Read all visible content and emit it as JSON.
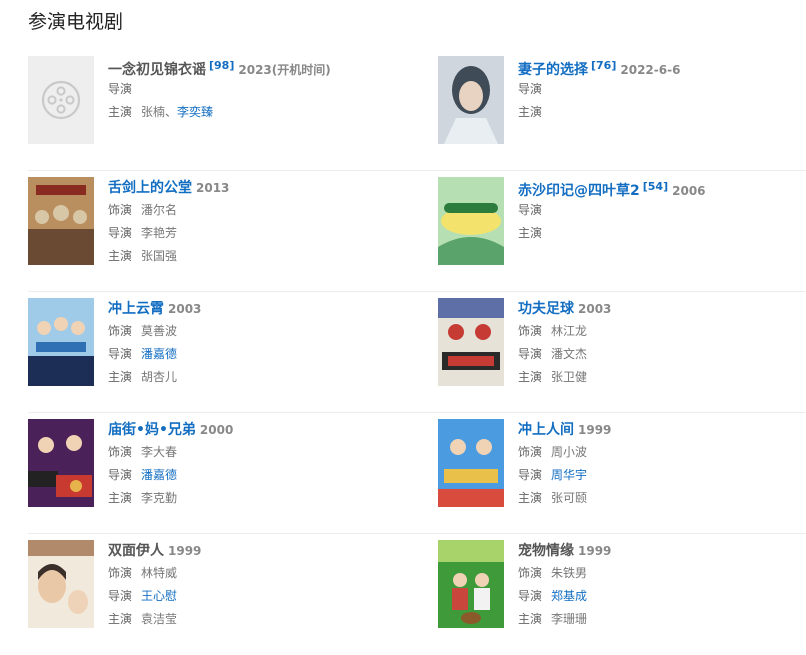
{
  "section_title": "参演电视剧",
  "labels": {
    "role": "饰演",
    "director": "导演",
    "star": "主演"
  },
  "items": [
    {
      "title": "一念初见锦衣谣",
      "ref": "[98]",
      "year": "2023(开机时间)",
      "director": "",
      "star_1": "张楠",
      "star_sep": "、",
      "star_2": "李奕臻",
      "poster": "film-reel-placeholder"
    },
    {
      "title": "妻子的选择",
      "ref": "[76]",
      "year": "2022-6-6",
      "director": "",
      "star": "",
      "poster_colors": [
        "#cfd6de",
        "#3f4c57",
        "#e8d2c2"
      ]
    },
    {
      "title": "舌剑上的公堂",
      "year": "2013",
      "role": "潘尔名",
      "director": "李艳芳",
      "star": "张国强",
      "poster_colors": [
        "#b98f5f",
        "#6b4a33",
        "#d8c7a6"
      ]
    },
    {
      "title": "赤沙印记@四叶草2",
      "ref": "[54]",
      "year": "2006",
      "director": "",
      "star": "",
      "poster_colors": [
        "#5aa36a",
        "#b6e0b3",
        "#f3e36d"
      ]
    },
    {
      "title": "冲上云霄",
      "year": "2003",
      "role": "莫善波",
      "director": "潘嘉德",
      "star": "胡杏儿",
      "poster_colors": [
        "#2f6fb3",
        "#9fcbe8",
        "#1c2e55"
      ]
    },
    {
      "title": "功夫足球",
      "year": "2003",
      "role": "林江龙",
      "director": "潘文杰",
      "star": "张卫健",
      "poster_colors": [
        "#c63b34",
        "#5e6fa8",
        "#e7e2d8"
      ]
    },
    {
      "title": "庙街•妈•兄弟",
      "year": "2000",
      "role": "李大春",
      "director": "潘嘉德",
      "star": "李克勤",
      "poster_colors": [
        "#4a2259",
        "#c8392f",
        "#e7b34b"
      ]
    },
    {
      "title": "冲上人间",
      "year": "1999",
      "role": "周小波",
      "director": "周华宇",
      "star": "张可颐",
      "poster_colors": [
        "#4b9be0",
        "#e9c14a",
        "#d94b3c"
      ]
    },
    {
      "title": "双面伊人",
      "year": "1999",
      "role": "林特威",
      "director": "王心慰",
      "star": "袁洁莹",
      "poster_colors": [
        "#f1e9dc",
        "#b08a6a",
        "#3b2f2a"
      ]
    },
    {
      "title": "宠物情缘",
      "year": "1999",
      "role": "朱铁男",
      "director": "郑基成",
      "star": "李珊珊",
      "poster_colors": [
        "#3f9a3a",
        "#a7d36a",
        "#c9463c"
      ]
    }
  ]
}
